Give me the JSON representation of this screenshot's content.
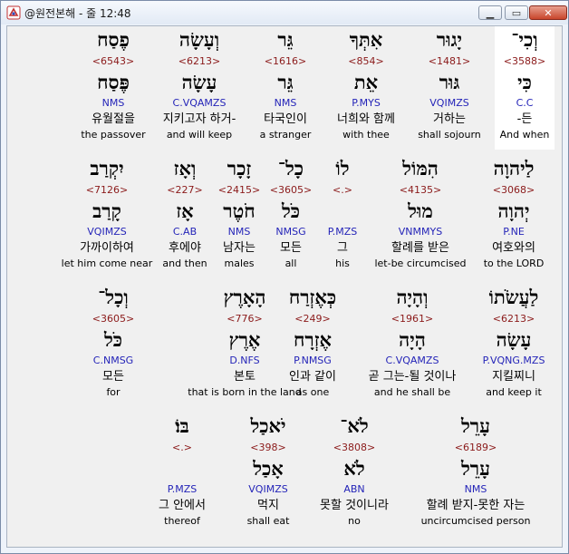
{
  "window": {
    "title": "@원전본해 - 줄 12:48",
    "minimize_icon": "minimize-icon",
    "maximize_icon": "maximize-icon",
    "close_icon": "close-icon"
  },
  "colors": {
    "strong": "#8b1a1a",
    "morph": "#2424b8",
    "highlight": "#ffffff"
  },
  "rows": [
    [
      {
        "heb": "וְכִי־",
        "strong": "<3588>",
        "lemma": "כִּי",
        "morph": "C.C",
        "korean": "-든",
        "english": "And when"
      },
      {
        "heb": "יָגוּר",
        "strong": "<1481>",
        "lemma": "גּוּר",
        "morph": "VQIMZS",
        "korean": "거하는",
        "english": "shall sojourn"
      },
      {
        "heb": "אִתְּךָ",
        "strong": "<854>",
        "lemma": "אֵת",
        "morph": "P.MYS",
        "korean": "너희와 함께",
        "english": "with thee"
      },
      {
        "heb": "גֵּר",
        "strong": "<1616>",
        "lemma": "גֵּר",
        "morph": "NMS",
        "korean": "타국인이",
        "english": "a stranger"
      },
      {
        "heb": "וְעָשָׂה",
        "strong": "<6213>",
        "lemma": "עָשָׂה",
        "morph": "C.VQAMZS",
        "korean": "지키고자 하거-",
        "english": "and will keep"
      },
      {
        "heb": "פֶסַח",
        "strong": "<6543>",
        "lemma": "פֶּסַח",
        "morph": "NMS",
        "korean": "유월절을",
        "english": "the passover"
      }
    ],
    [
      {
        "heb": "לַיהוָה",
        "strong": "<3068>",
        "lemma": "יְהוָה",
        "morph": "P.NE",
        "korean": "여호와의",
        "english": "to the LORD"
      },
      {
        "heb": "הִמּוֹל",
        "strong": "<4135>",
        "lemma": "מוּל",
        "morph": "VNMMYS",
        "korean": "할례를 받은",
        "english": "let-be circumcised"
      },
      {
        "heb": "לוֹ",
        "strong": "<.>",
        "lemma": "",
        "morph": "P.MZS",
        "korean": "그",
        "english": "his"
      },
      {
        "heb": "כָל־",
        "strong": "<3605>",
        "lemma": "כֹּל",
        "morph": "NMSG",
        "korean": "모든",
        "english": "all"
      },
      {
        "heb": "זָכָר",
        "strong": "<2415>",
        "lemma": "חֹטֶר",
        "morph": "NMS",
        "korean": "남자는",
        "english": "males"
      },
      {
        "heb": "וְאָז",
        "strong": "<227>",
        "lemma": "אָז",
        "morph": "C.AB",
        "korean": "후에야",
        "english": "and then"
      },
      {
        "heb": "יִקְרַב",
        "strong": "<7126>",
        "lemma": "קָרַב",
        "morph": "VQIMZS",
        "korean": "가까이하여",
        "english": "let him come near"
      }
    ],
    [
      {
        "heb": "לַעֲשֹׂתוֹ",
        "strong": "<6213>",
        "lemma": "עָשָׂה",
        "morph": "P.VQNG.MZS",
        "korean": "지킬찌니",
        "english": "and keep it"
      },
      {
        "heb": "וְהָיָה",
        "strong": "<1961>",
        "lemma": "הָיָה",
        "morph": "C.VQAMZS",
        "korean": "곧 그는-될 것이나",
        "english": "and he shall be"
      },
      {
        "heb": "כְּאֶזְרַח",
        "strong": "<249>",
        "lemma": "אֶזְרָח",
        "morph": "P.NMSG",
        "korean": "인과 같이",
        "english": "as one"
      },
      {
        "heb": "הָאָרֶץ",
        "strong": "<776>",
        "lemma": "אֶרֶץ",
        "morph": "D.NFS",
        "korean": "본토",
        "english": "that is born in the land"
      },
      {
        "heb": "וְכָל־",
        "strong": "<3605>",
        "lemma": "כֹּל",
        "morph": "C.NMSG",
        "korean": "모든",
        "english": "for"
      }
    ],
    [
      {
        "heb": "עָרֵל",
        "strong": "<6189>",
        "lemma": "עָרֵל",
        "morph": "NMS",
        "korean": "할례 받지-못한 자는",
        "english": "uncircumcised person"
      },
      {
        "heb": "לֹא־",
        "strong": "<3808>",
        "lemma": "לֹא",
        "morph": "ABN",
        "korean": "못할 것이니라",
        "english": "no"
      },
      {
        "heb": "יֹאכַל",
        "strong": "<398>",
        "lemma": "אָכַל",
        "morph": "VQIMZS",
        "korean": "먹지",
        "english": "shall eat"
      },
      {
        "heb": "בּוֹ׃",
        "strong": "<.>",
        "lemma": "",
        "morph": "P.MZS",
        "korean": "그 안에서",
        "english": "thereof"
      }
    ]
  ]
}
